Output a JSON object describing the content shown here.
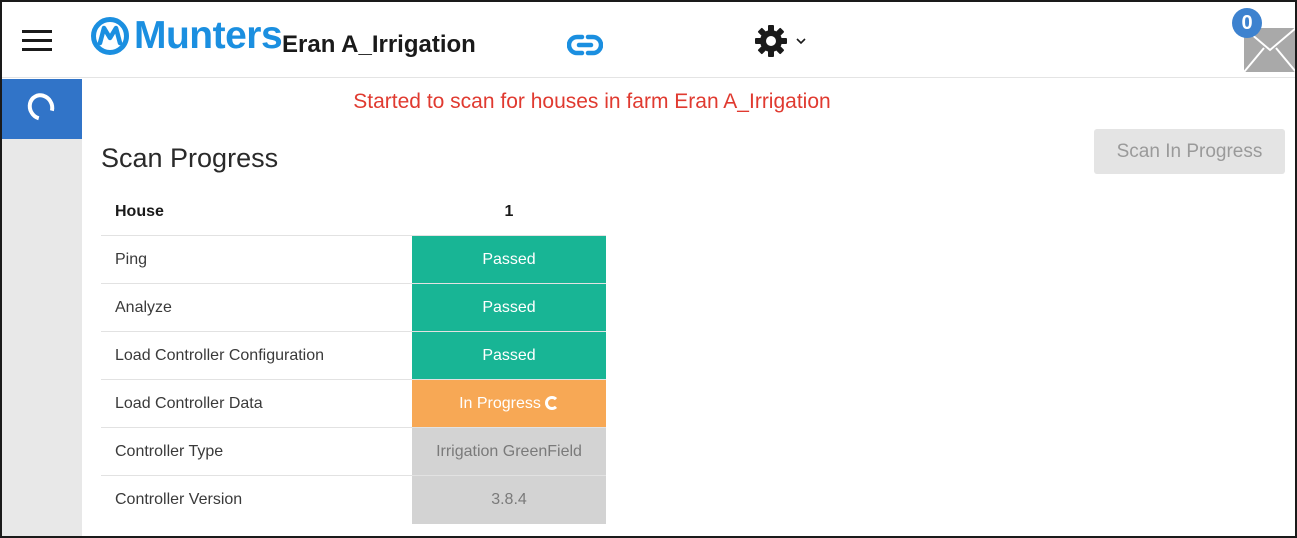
{
  "header": {
    "logo_text": "Munters",
    "farm_name": "Eran A_Irrigation",
    "notification_count": "0",
    "icons": [
      "menu-icon",
      "munters-logo-icon",
      "link-icon",
      "gear-icon",
      "chevron-down-icon",
      "mail-icon"
    ]
  },
  "sidebar": {
    "icon": "refresh-icon"
  },
  "main": {
    "message": "Started to scan for houses in farm Eran A_Irrigation",
    "title": "Scan Progress",
    "scan_button_label": "Scan In Progress"
  },
  "table": {
    "header": {
      "label": "House",
      "value": "1"
    },
    "rows": [
      {
        "label": "Ping",
        "value": "Passed",
        "status": "passed"
      },
      {
        "label": "Analyze",
        "value": "Passed",
        "status": "passed"
      },
      {
        "label": "Load Controller Configuration",
        "value": "Passed",
        "status": "passed"
      },
      {
        "label": "Load Controller Data",
        "value": "In Progress",
        "status": "in-progress"
      },
      {
        "label": "Controller Type",
        "value": "Irrigation GreenField",
        "status": "info"
      },
      {
        "label": "Controller Version",
        "value": "3.8.4",
        "status": "info"
      }
    ]
  },
  "colors": {
    "brand": "#1b8fe0",
    "message": "#e03a30",
    "passed": "#18b595",
    "in_progress": "#f7a855",
    "info": "#d3d3d3",
    "rail_accent": "#3174c8"
  }
}
